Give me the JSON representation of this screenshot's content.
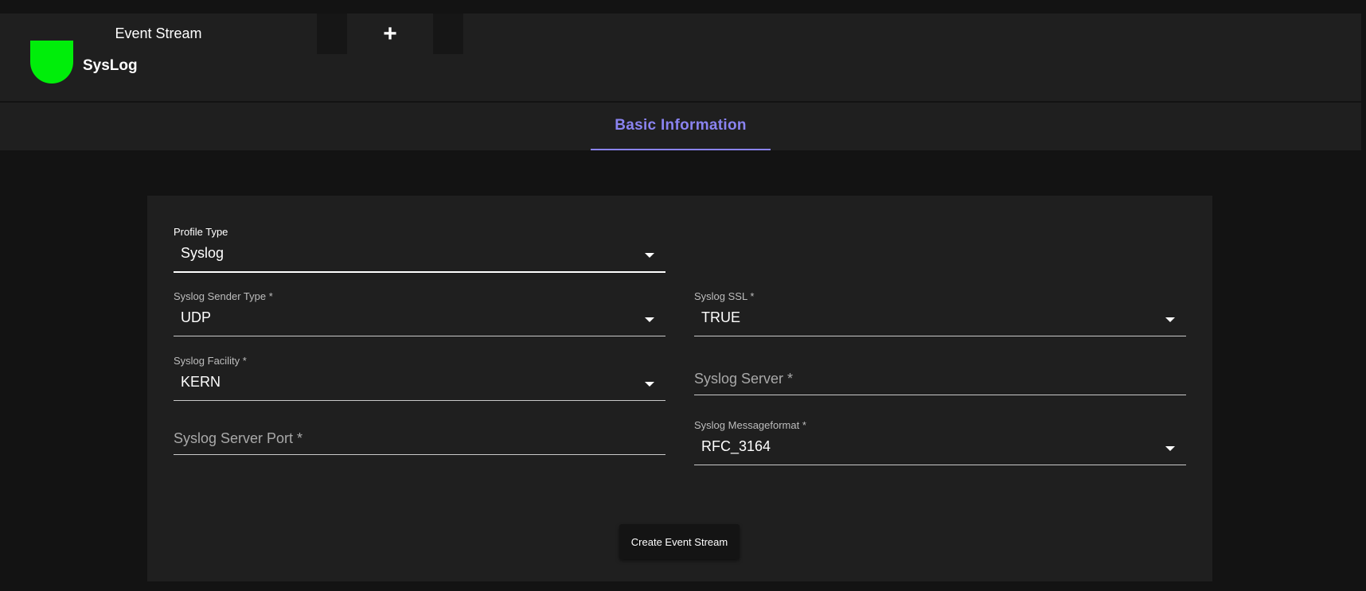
{
  "tabs": {
    "event_stream_label": "Event Stream",
    "add_label": "+"
  },
  "stream": {
    "name": "SysLog",
    "status_color": "#00ee0a"
  },
  "section_tabs": {
    "basic_information": "Basic Information"
  },
  "form": {
    "profile_type": {
      "label": "Profile Type",
      "value": "Syslog"
    },
    "sender_type": {
      "label": "Syslog Sender Type *",
      "value": "UDP"
    },
    "ssl": {
      "label": "Syslog SSL *",
      "value": "TRUE"
    },
    "facility": {
      "label": "Syslog Facility *",
      "value": "KERN"
    },
    "server": {
      "placeholder": "Syslog Server *"
    },
    "server_port": {
      "placeholder": "Syslog Server Port *"
    },
    "messageformat": {
      "label": "Syslog Messageformat *",
      "value": "RFC_3164"
    },
    "submit_label": "Create Event Stream"
  },
  "colors": {
    "accent": "#8a83f0",
    "background": "#131313",
    "surface": "#1f1f1f"
  }
}
